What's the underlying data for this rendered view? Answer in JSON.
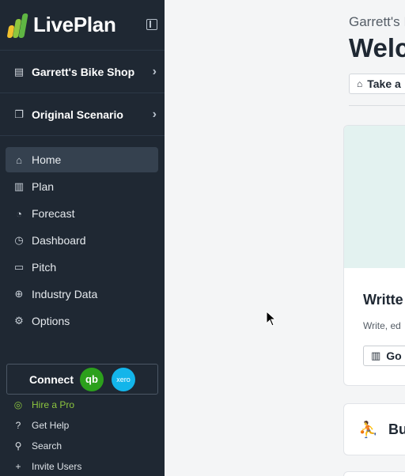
{
  "app": {
    "name": "LivePlan"
  },
  "sidebar": {
    "company": "Garrett's Bike Shop",
    "scenario": "Original Scenario",
    "nav": [
      {
        "label": "Home",
        "icon": "home-icon",
        "active": true
      },
      {
        "label": "Plan",
        "icon": "plan-icon",
        "active": false
      },
      {
        "label": "Forecast",
        "icon": "forecast-icon",
        "active": false
      },
      {
        "label": "Dashboard",
        "icon": "dashboard-icon",
        "active": false
      },
      {
        "label": "Pitch",
        "icon": "pitch-icon",
        "active": false
      },
      {
        "label": "Industry Data",
        "icon": "industry-data-icon",
        "active": false
      },
      {
        "label": "Options",
        "icon": "gear-icon",
        "active": false
      }
    ],
    "connect": {
      "label": "Connect",
      "quickbooks": "qb",
      "xero": "xero"
    },
    "footer": [
      {
        "label": "Hire a Pro",
        "icon": "compass-icon"
      },
      {
        "label": "Get Help",
        "icon": "help-icon"
      },
      {
        "label": "Search",
        "icon": "search-icon"
      },
      {
        "label": "Invite Users",
        "icon": "invite-users-icon"
      }
    ]
  },
  "main": {
    "greeting": "Garrett's I",
    "welcome": "Welc",
    "tour_button": "Take a",
    "card": {
      "title": "Writte",
      "description": "Write, ed",
      "button": "Go"
    },
    "card2": {
      "title": "Bu"
    }
  },
  "colors": {
    "sidebar_bg": "#1f2833",
    "accent_green": "#8dc63f",
    "hero_bg": "#e3f2f0"
  }
}
